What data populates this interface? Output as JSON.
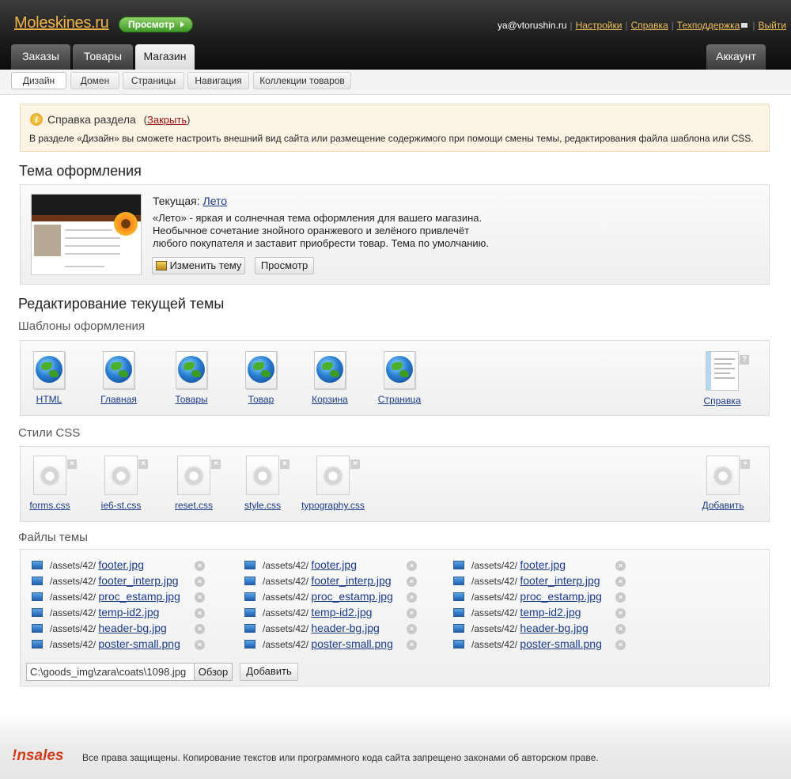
{
  "header": {
    "logo": "Moleskines.ru",
    "preview_button": "Просмотр",
    "user": "ya@vtorushin.ru",
    "links": [
      "Настройки",
      "Справка",
      "Техподдержка",
      "Выйти"
    ],
    "tabs": [
      "Заказы",
      "Товары",
      "Магазин"
    ],
    "active_tab": "Магазин",
    "account": "Аккаунт"
  },
  "subnav": {
    "tabs": [
      "Дизайн",
      "Домен",
      "Страницы",
      "Навигация",
      "Коллекции товаров"
    ],
    "active": "Дизайн"
  },
  "help": {
    "title": "Справка раздела",
    "close_label": "Закрыть",
    "text": "В разделе «Дизайн» вы сможете настроить внешний вид сайта или размещение содержимого при помощи смены темы, редактирования файла шаблона или CSS."
  },
  "theme": {
    "heading": "Тема оформления",
    "current_label": "Текущая:",
    "current_name": "Лето",
    "description": "«Лето» - яркая и солнечная тема оформления для вашего магазина. Необычное сочетание знойного оранжевого и зелёного привлечёт любого покупателя и заставит приобрести товар. Тема по умолчанию.",
    "change_button": "Изменить тему",
    "preview_button": "Просмотр"
  },
  "edit": {
    "heading": "Редактирование текущей темы",
    "templates_heading": "Шаблоны оформления",
    "templates": [
      "HTML",
      "Главная",
      "Товары",
      "Товар",
      "Корзина",
      "Страница"
    ],
    "help_label": "Справка",
    "css_heading": "Стили CSS",
    "css_files": [
      "forms.css",
      "ie6-st.css",
      "reset.css",
      "style.css",
      "typography.css"
    ],
    "css_add": "Добавить",
    "files_heading": "Файлы темы",
    "file_prefix": "/assets/42/",
    "files": [
      "footer.jpg",
      "footer_interp.jpg",
      "proc_estamp.jpg",
      "temp-id2.jpg",
      "header-bg.jpg",
      "poster-small.png"
    ],
    "upload_value": "C:\\goods_img\\zara\\coats\\1098.jpg",
    "browse_button": "Обзор",
    "add_button": "Добавить"
  },
  "footer": {
    "brand": "!nsales",
    "copyright": "Все права защищены. Копирование текстов или программного кода сайта запрещено законами об авторском праве."
  }
}
